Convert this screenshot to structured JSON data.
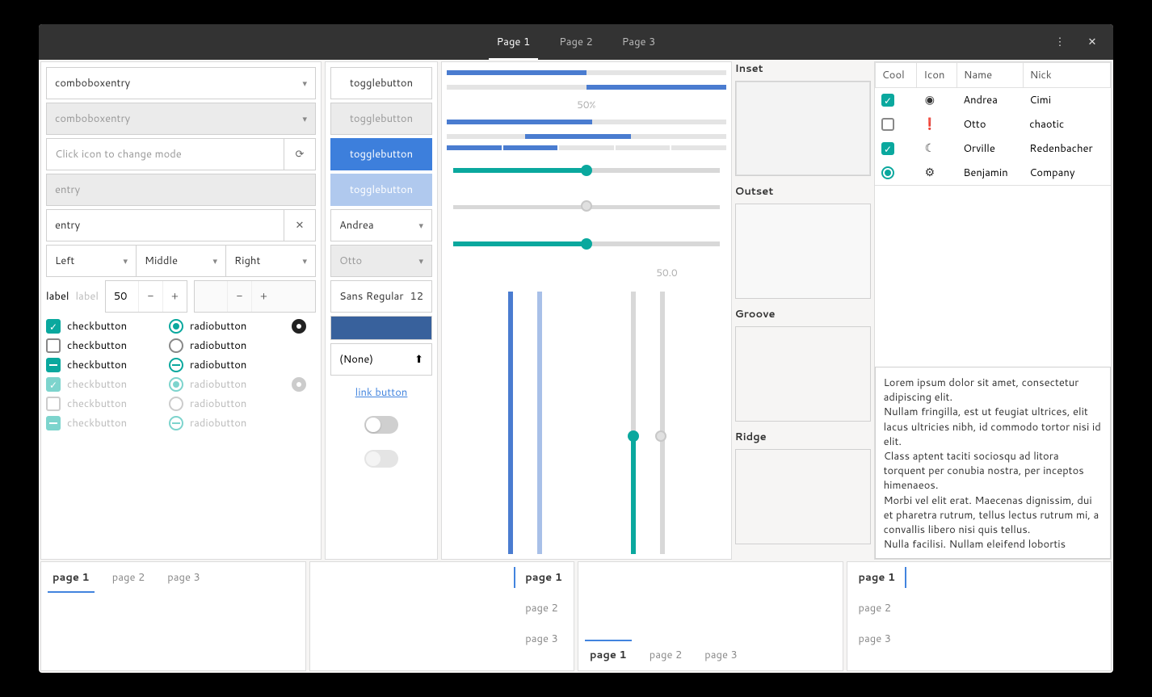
{
  "header": {
    "tabs": [
      "Page 1",
      "Page 2",
      "Page 3"
    ],
    "active_tab": 0
  },
  "col1": {
    "combo1": "comboboxentry",
    "combo2_placeholder": "comboboxentry",
    "entry_mode_placeholder": "Click icon to change mode",
    "entry_disabled_placeholder": "entry",
    "entry_value": "entry",
    "align": {
      "left": "Left",
      "middle": "Middle",
      "right": "Right"
    },
    "label": "label",
    "label_disabled": "label",
    "spin_value": "50",
    "check_label": "checkbutton",
    "radio_label": "radiobutton"
  },
  "col2": {
    "toggle_label": "togglebutton",
    "combo_andrea": "Andrea",
    "combo_otto": "Otto",
    "font_name": "Sans Regular",
    "font_size": "12",
    "file_none": "(None)",
    "link_label": "link button"
  },
  "col3": {
    "pct_label": "50%",
    "v_label": "50.0"
  },
  "col4": {
    "inset": "Inset",
    "outset": "Outset",
    "groove": "Groove",
    "ridge": "Ridge"
  },
  "col5": {
    "headers": {
      "cool": "Cool",
      "icon": "Icon",
      "name": "Name",
      "nick": "Nick"
    },
    "rows": [
      {
        "cool": "check-on",
        "icon": "check-badge",
        "name": "Andrea",
        "nick": "Cimi"
      },
      {
        "cool": "check-off",
        "icon": "alert",
        "name": "Otto",
        "nick": "chaotic"
      },
      {
        "cool": "check-on",
        "icon": "moon",
        "name": "Orville",
        "nick": "Redenbacher"
      },
      {
        "cool": "radio-on",
        "icon": "gear",
        "name": "Benjamin",
        "nick": "Company"
      }
    ],
    "lorem": "Lorem ipsum dolor sit amet, consectetur adipiscing elit.\nNullam fringilla, est ut feugiat ultrices, elit lacus ultricies nibh, id commodo tortor nisi id elit.\nClass aptent taciti sociosqu ad litora torquent per conubia nostra, per inceptos himenaeos.\nMorbi vel elit erat. Maecenas dignissim, dui et pharetra rutrum, tellus lectus rutrum mi, a convallis libero nisi quis tellus.\nNulla facilisi. Nullam eleifend lobortis"
  },
  "notebooks": {
    "pages": [
      "page 1",
      "page 2",
      "page 3"
    ]
  }
}
